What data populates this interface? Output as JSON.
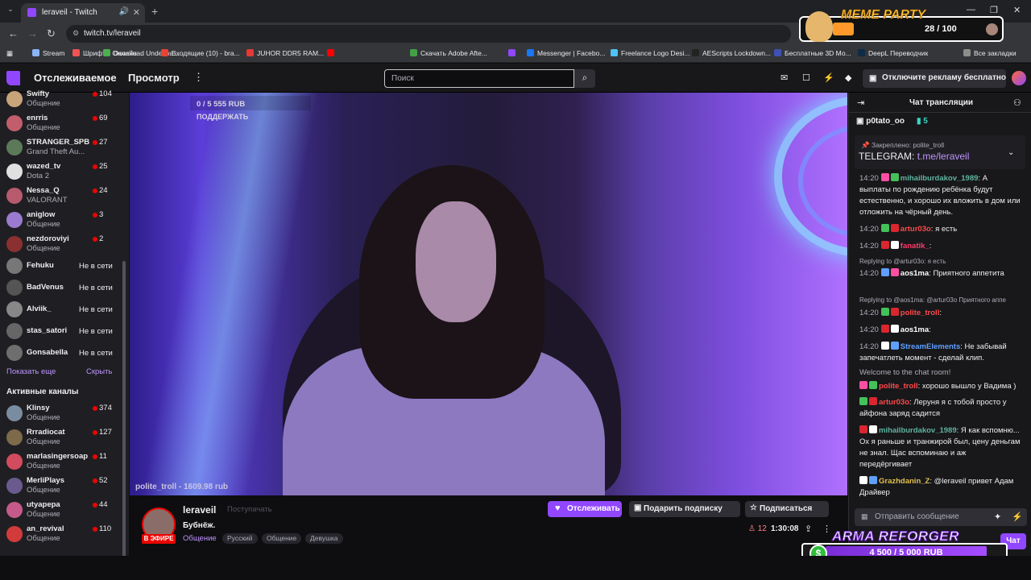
{
  "browser": {
    "tab_title": "leraveil - Twitch",
    "url": "twitch.tv/leraveil",
    "new_tab": "+",
    "bookmarks": [
      {
        "label": "Stream",
        "color": "#8ab4f8"
      },
      {
        "label": "Шрифты Онлайн",
        "color": "#f05454"
      },
      {
        "label": "Download Underwa...",
        "color": "#4caf50"
      },
      {
        "label": "Входящие (10) - bra...",
        "color": "#ea4335"
      },
      {
        "label": "JUHOR DDR5 RAM...",
        "color": "#e53935"
      },
      {
        "label": "",
        "color": "#ff0000"
      },
      {
        "label": "Скачать Adobe Afte...",
        "color": "#43a047"
      },
      {
        "label": "",
        "color": "#9147ff"
      },
      {
        "label": "Messenger | Facebo...",
        "color": "#1877f2"
      },
      {
        "label": "Freelance Logo Desi...",
        "color": "#4fc3f7"
      },
      {
        "label": "AEScripts Lockdown...",
        "color": "#222222"
      },
      {
        "label": "Бесплатные 3D Мо...",
        "color": "#3f51b5"
      },
      {
        "label": "DeepL Переводчик",
        "color": "#0f2b46"
      },
      {
        "label": "Все закладки",
        "color": "#8d8d8d"
      }
    ]
  },
  "meme_widget": {
    "title": "MEME PARTY",
    "count": "28 / 100"
  },
  "topnav": {
    "following": "Отслеживаемое",
    "browse": "Просмотр",
    "search_placeholder": "Поиск",
    "adfree": "Отключите рекламу бесплатно"
  },
  "sidebar": {
    "followed": [
      {
        "name": "Swifty",
        "category": "Общение",
        "viewers": "104",
        "color": "#c9a47a"
      },
      {
        "name": "enrris",
        "category": "Общение",
        "viewers": "69",
        "color": "#c25e6b"
      },
      {
        "name": "STRANGER_SPB",
        "category": "Grand Theft Au...",
        "viewers": "27",
        "color": "#5c7a5a"
      },
      {
        "name": "wazed_tv",
        "category": "Dota 2",
        "viewers": "25",
        "color": "#e0e0e0"
      },
      {
        "name": "Nessa_Q",
        "category": "VALORANT",
        "viewers": "24",
        "color": "#b85a6d"
      },
      {
        "name": "aniglow",
        "category": "Общение",
        "viewers": "3",
        "color": "#9b7bd0"
      },
      {
        "name": "nezdoroviyi",
        "category": "Общение",
        "viewers": "2",
        "color": "#8a3030"
      }
    ],
    "offline": [
      {
        "name": "Fehuku",
        "status": "Не в сети",
        "color": "#777"
      },
      {
        "name": "BadVenus",
        "status": "Не в сети",
        "color": "#555"
      },
      {
        "name": "Alviik_",
        "status": "Не в сети",
        "color": "#888"
      },
      {
        "name": "stas_satori",
        "status": "Не в сети",
        "color": "#666"
      },
      {
        "name": "Gonsabella",
        "status": "Не в сети",
        "color": "#6e6e6e"
      }
    ],
    "show_more": "Показать еще",
    "hide": "Скрыть",
    "active_header": "Активные каналы",
    "active": [
      {
        "name": "Klinsy",
        "category": "Общение",
        "viewers": "374",
        "color": "#7a8ca0"
      },
      {
        "name": "Rrradiocat",
        "category": "Общение",
        "viewers": "127",
        "color": "#7c6a4a"
      },
      {
        "name": "marlasingersoap",
        "category": "Общение",
        "viewers": "11",
        "color": "#d34b5e"
      },
      {
        "name": "MerliPlays",
        "category": "Общение",
        "viewers": "52",
        "color": "#6b5a8e"
      },
      {
        "name": "utyapepa",
        "category": "Общение",
        "viewers": "44",
        "color": "#c45a8a"
      },
      {
        "name": "an_revival",
        "category": "Общение",
        "viewers": "110",
        "color": "#d33b3b"
      }
    ]
  },
  "video": {
    "goal": "0 / 5 555 RUB",
    "goal_sub": "ПОДДЕРЖАТЬ",
    "donor": "polite_troll - 1609.98 rub"
  },
  "stream": {
    "name": "leraveil",
    "ghost": "Поступачать",
    "title": "Бубнёж.",
    "live": "В ЭФИРЕ",
    "category": "Общение",
    "tags": [
      "Русский",
      "Общение",
      "Девушка"
    ],
    "follow": "Отслеживать",
    "sub": "Подарить подписку",
    "subscribe": "Подписаться",
    "viewers": "12",
    "uptime": "1:30:08"
  },
  "chat": {
    "title": "Чат трансляции",
    "gifter": "p0tato_oo",
    "gift_count": "5",
    "pinned_label": "Закреплено: polite_troll",
    "pinned_prefix": "TELEGRAM: ",
    "pinned_link": "t.me/leraveil",
    "input_placeholder": "Отправить сообщение",
    "chat_button": "Чат",
    "messages": [
      {
        "time": "14:20",
        "user": "mihailburdakov_1989",
        "color": "#5fb3a0",
        "text": ": А выплаты по рождению ребёнка будут естественно, и хорошо их вложить в дом или отложить на чёрный день."
      },
      {
        "time": "14:20",
        "user": "artur03o",
        "color": "#ff4a4a",
        "text": ": я есть"
      },
      {
        "time": "14:20",
        "user": "fanatik_",
        "color": "#ff3a6a",
        "text": ":"
      },
      {
        "reply": "Replying to @artur03o: я есть"
      },
      {
        "time": "14:20",
        "user": "aos1ma",
        "color": "#ffffff",
        "text": ": Приятного аппетита"
      },
      {
        "reply": "Replying to @aos1ma: @artur03o Приятного аппе"
      },
      {
        "time": "14:20",
        "user": "polite_troll",
        "color": "#ff4a4a",
        "text": ":"
      },
      {
        "time": "14:20",
        "user": "aos1ma",
        "color": "#ffffff",
        "text": ":"
      },
      {
        "time": "14:20",
        "user": "StreamElements",
        "color": "#5fa0ff",
        "text": ": Не забывай запечатлеть момент - сделай клип."
      },
      {
        "sys": "Welcome to the chat room!"
      },
      {
        "user": "polite_troll",
        "color": "#ff4a4a",
        "text": ": хорошо вышло у Вадима )"
      },
      {
        "user": "artur03o",
        "color": "#ff4a4a",
        "text": ": Леруня я с тобой просто у айфона заряд садится"
      },
      {
        "user": "mihailburdakov_1989",
        "color": "#5fb3a0",
        "text": ": Я как вспомню... Ох я раньше и транжирой был, цену деньгам не знал. Щас вспоминаю и аж передёргивает"
      },
      {
        "user": "Grazhdanin_Z",
        "color": "#e0c050",
        "text": ": @leraveil привет Адам Драйвер"
      }
    ]
  },
  "arma": {
    "title": "ARMA REFORGER",
    "amount": "4 500 / 5 000 RUB",
    "coin": "$"
  }
}
